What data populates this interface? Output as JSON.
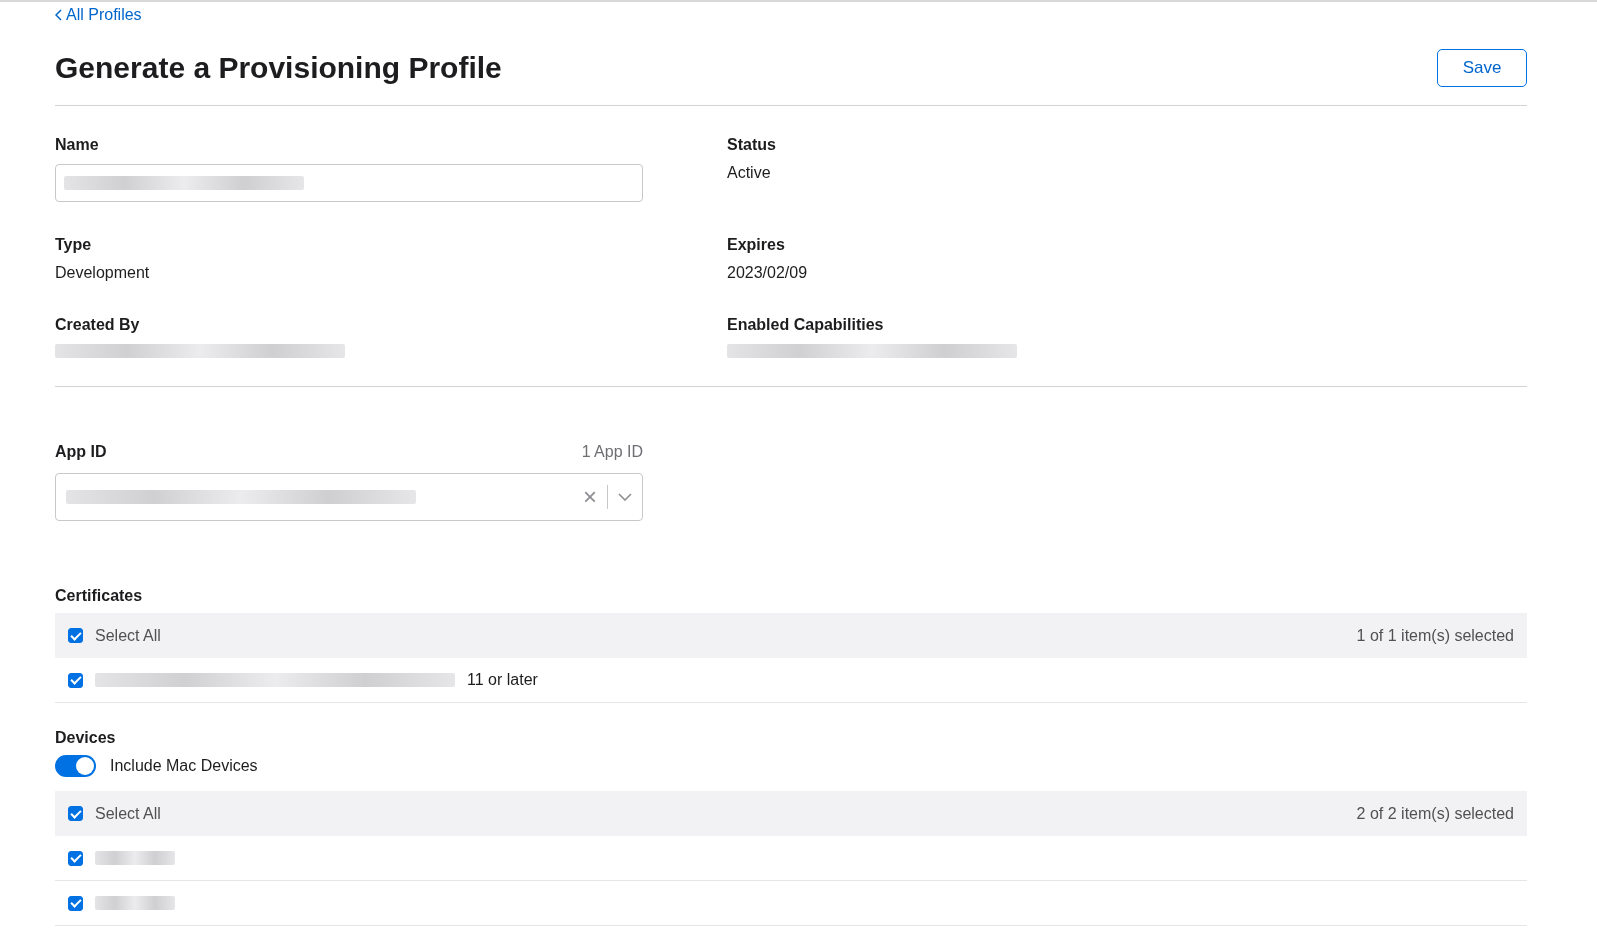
{
  "back_link": {
    "label": "All Profiles"
  },
  "title": "Generate a Provisioning Profile",
  "save_button": "Save",
  "details": [
    {
      "label": "Name",
      "kind": "field"
    },
    {
      "label": "Status",
      "kind": "text",
      "value": "Active"
    },
    {
      "label": "Type",
      "kind": "text",
      "value": "Development"
    },
    {
      "label": "Expires",
      "kind": "text",
      "value": "2023/02/09"
    },
    {
      "label": "Created By",
      "kind": "redacted"
    },
    {
      "label": "Enabled Capabilities",
      "kind": "redacted"
    }
  ],
  "app_id": {
    "label": "App ID",
    "count": "1 App ID",
    "clear": "×"
  },
  "certificates": {
    "title": "Certificates",
    "select_all": {
      "label": "Select All",
      "checked": true,
      "summary": "1 of 1 item(s) selected"
    },
    "items": [
      {
        "checked": true,
        "text": "11 or later"
      }
    ]
  },
  "devices": {
    "title": "Devices",
    "toggle": {
      "label": "Include Mac Devices",
      "on": true
    },
    "select_all": {
      "label": "Select All",
      "checked": true,
      "summary": "2 of 2 item(s) selected"
    },
    "items": [
      {
        "checked": true
      },
      {
        "checked": true
      }
    ]
  }
}
